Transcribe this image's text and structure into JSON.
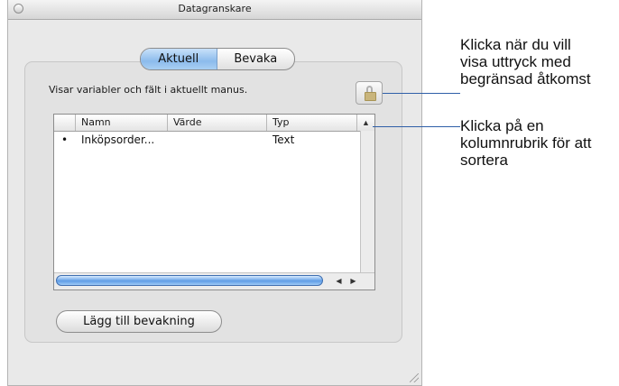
{
  "window": {
    "title": "Datagranskare"
  },
  "tabs": [
    {
      "label": "Aktuell",
      "selected": true
    },
    {
      "label": "Bevaka",
      "selected": false
    }
  ],
  "description": "Visar variabler och fält i aktuellt manus.",
  "table": {
    "columns": [
      "Namn",
      "Värde",
      "Typ"
    ],
    "sort_indicator": "▲",
    "rows": [
      {
        "bullet": "•",
        "name": "Inköpsorder...",
        "value": "",
        "type": "Text"
      }
    ]
  },
  "scroll_arrows": {
    "left": "◀",
    "right": "▶"
  },
  "add_watch_button": "Lägg till bevakning",
  "callouts": {
    "lock": "Klicka när du vill\nvisa uttryck med\nbegränsad åtkomst",
    "sort": "Klicka på en\nkolumnrubrik för att\nsortera"
  }
}
